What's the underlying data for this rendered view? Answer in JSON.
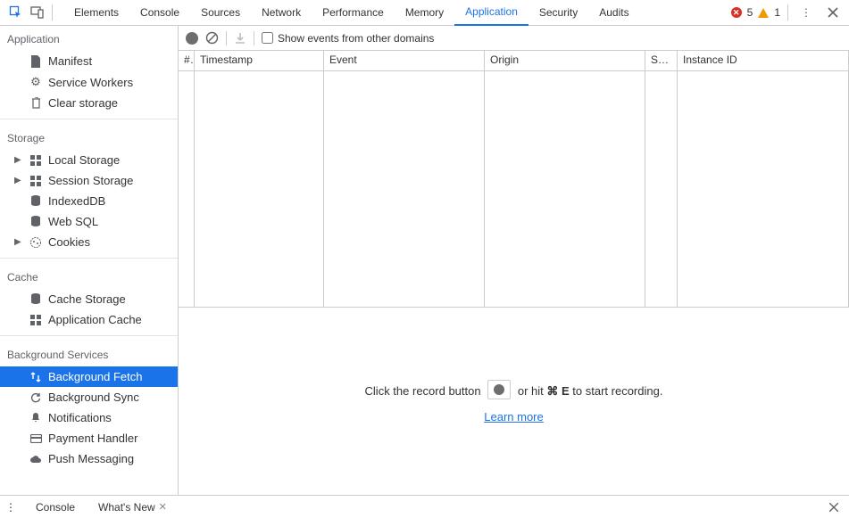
{
  "topbar": {
    "tabs": [
      "Elements",
      "Console",
      "Sources",
      "Network",
      "Performance",
      "Memory",
      "Application",
      "Security",
      "Audits"
    ],
    "active_tab": "Application",
    "errors": 5,
    "warnings": 1
  },
  "sidebar": {
    "sections": [
      {
        "title": "Application",
        "items": [
          {
            "label": "Manifest",
            "icon": "file",
            "expand": false
          },
          {
            "label": "Service Workers",
            "icon": "gear",
            "expand": false
          },
          {
            "label": "Clear storage",
            "icon": "trash",
            "expand": false
          }
        ]
      },
      {
        "title": "Storage",
        "items": [
          {
            "label": "Local Storage",
            "icon": "grid",
            "expand": true
          },
          {
            "label": "Session Storage",
            "icon": "grid",
            "expand": true
          },
          {
            "label": "IndexedDB",
            "icon": "db",
            "expand": false
          },
          {
            "label": "Web SQL",
            "icon": "db",
            "expand": false
          },
          {
            "label": "Cookies",
            "icon": "cookie",
            "expand": true
          }
        ]
      },
      {
        "title": "Cache",
        "items": [
          {
            "label": "Cache Storage",
            "icon": "db",
            "expand": false
          },
          {
            "label": "Application Cache",
            "icon": "grid",
            "expand": false
          }
        ]
      },
      {
        "title": "Background Services",
        "items": [
          {
            "label": "Background Fetch",
            "icon": "swap",
            "expand": false,
            "selected": true
          },
          {
            "label": "Background Sync",
            "icon": "sync",
            "expand": false
          },
          {
            "label": "Notifications",
            "icon": "bell",
            "expand": false
          },
          {
            "label": "Payment Handler",
            "icon": "card",
            "expand": false
          },
          {
            "label": "Push Messaging",
            "icon": "cloud",
            "expand": false
          }
        ]
      }
    ]
  },
  "toolbar": {
    "checkbox_label": "Show events from other domains"
  },
  "table": {
    "cols": {
      "num": "#",
      "ts": "Timestamp",
      "ev": "Event",
      "or": "Origin",
      "sk": "S…",
      "id": "Instance ID"
    }
  },
  "placeholder": {
    "pre": "Click the record button",
    "post_a": "or hit ",
    "shortcut": "⌘ E",
    "post_b": " to start recording.",
    "link": "Learn more"
  },
  "drawer": {
    "tabs": [
      {
        "label": "Console",
        "closable": false
      },
      {
        "label": "What's New",
        "closable": true
      }
    ]
  }
}
